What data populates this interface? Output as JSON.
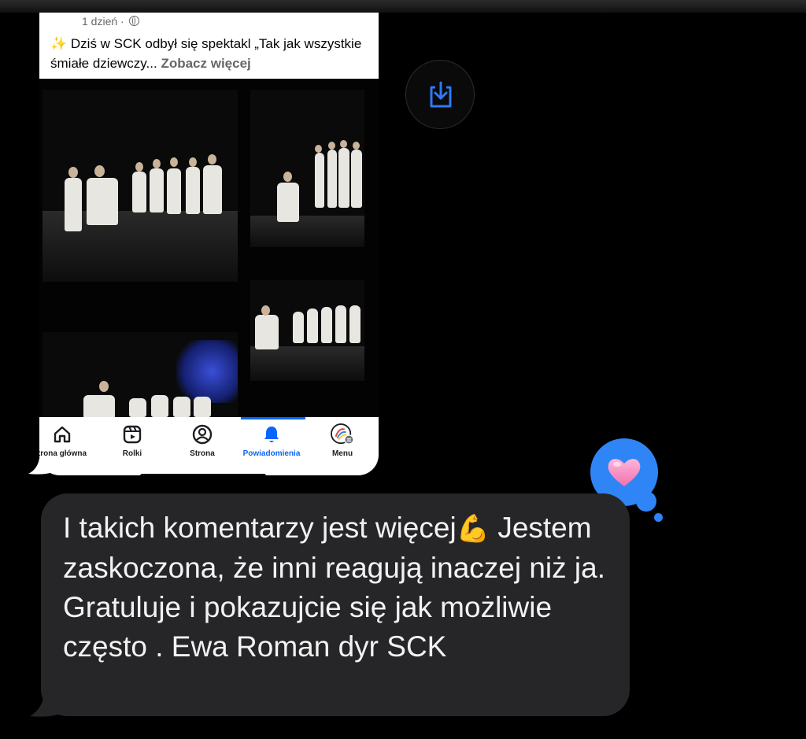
{
  "post": {
    "time": "1 dzień ·",
    "text_prefix": "✨",
    "text": "Dziś w SCK odbył się spektakl „Tak jak wszystkie śmiałe dziewczy...",
    "see_more": "Zobacz więcej"
  },
  "tabbar": {
    "items": [
      {
        "label": "trona główna",
        "icon": "home-icon"
      },
      {
        "label": "Rolki",
        "icon": "reels-icon"
      },
      {
        "label": "Strona",
        "icon": "profile-icon"
      },
      {
        "label": "Powiadomienia",
        "icon": "bell-icon",
        "active": true
      },
      {
        "label": "Menu",
        "icon": "menu-avatar-icon"
      }
    ],
    "active_color": "#0866ff"
  },
  "save_icon": "download-icon",
  "message": {
    "text": "I takich komentarzy jest więcej",
    "emoji": "💪",
    "text_rest": "Jestem zaskoczona, że inni reagują inaczej niż ja. Gratuluje i pokazujcie się jak możliwie często . Ewa Roman dyr SCK"
  },
  "reaction": {
    "icon": "heart-icon",
    "color": "#2f85f5"
  },
  "colors": {
    "bubble": "#262628",
    "background": "#000000"
  }
}
